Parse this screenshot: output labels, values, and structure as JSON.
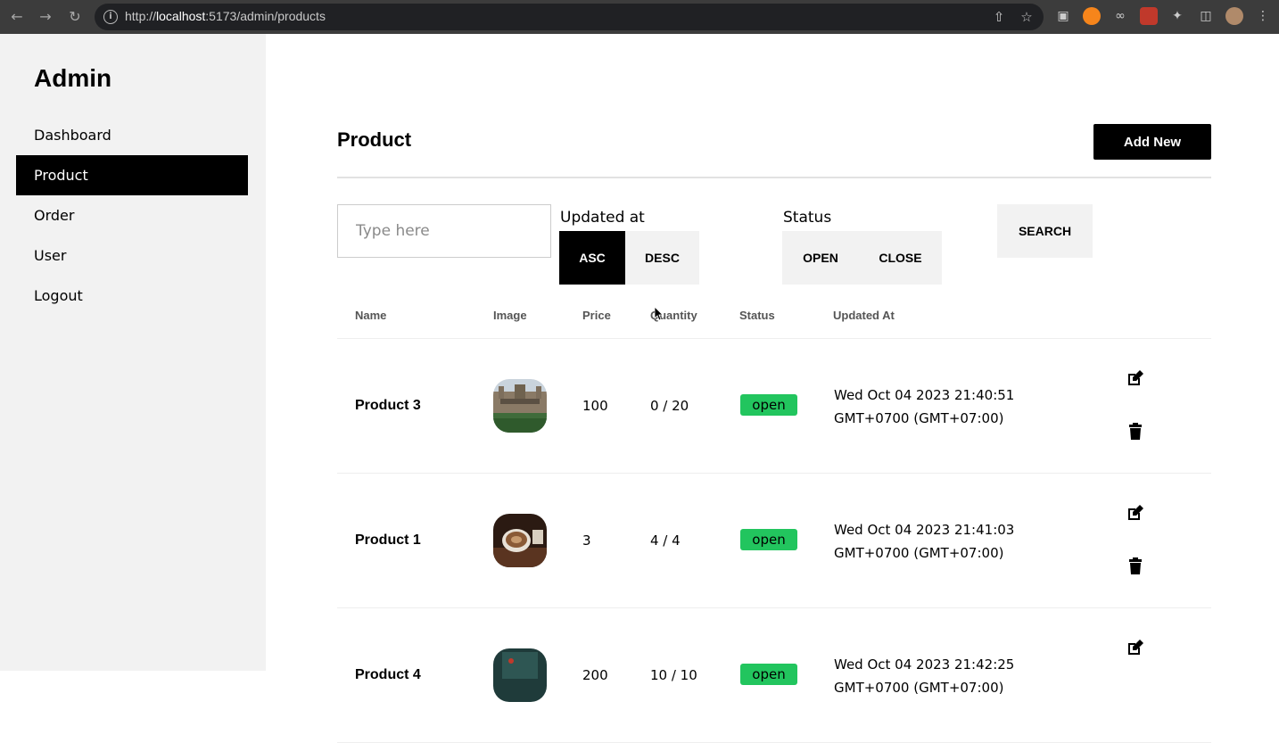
{
  "browser": {
    "url_prefix": "http://",
    "url_host": "localhost",
    "url_rest": ":5173/admin/products"
  },
  "sidebar": {
    "brand": "Admin",
    "items": [
      {
        "label": "Dashboard",
        "active": false
      },
      {
        "label": "Product",
        "active": true
      },
      {
        "label": "Order",
        "active": false
      },
      {
        "label": "User",
        "active": false
      },
      {
        "label": "Logout",
        "active": false
      }
    ]
  },
  "header": {
    "title": "Product",
    "add_label": "Add New"
  },
  "filters": {
    "search_placeholder": "Type here",
    "updated_label": "Updated at",
    "asc_label": "ASC",
    "desc_label": "DESC",
    "status_label": "Status",
    "open_label": "OPEN",
    "close_label": "CLOSE",
    "search_label": "SEARCH"
  },
  "table": {
    "columns": [
      "Name",
      "Image",
      "Price",
      "Quantity",
      "Status",
      "Updated At"
    ],
    "rows": [
      {
        "name": "Product 3",
        "price": "100",
        "quantity": "0 / 20",
        "status": "open",
        "updated_1": "Wed Oct 04 2023 21:40:51",
        "updated_2": "GMT+0700 (GMT+07:00)"
      },
      {
        "name": "Product 1",
        "price": "3",
        "quantity": "4 / 4",
        "status": "open",
        "updated_1": "Wed Oct 04 2023 21:41:03",
        "updated_2": "GMT+0700 (GMT+07:00)"
      },
      {
        "name": "Product 4",
        "price": "200",
        "quantity": "10 / 10",
        "status": "open",
        "updated_1": "Wed Oct 04 2023 21:42:25",
        "updated_2": "GMT+0700 (GMT+07:00)"
      }
    ]
  },
  "colors": {
    "status_open": "#22c55e",
    "active_nav": "#000000",
    "sidebar_bg": "#f2f2f2"
  }
}
